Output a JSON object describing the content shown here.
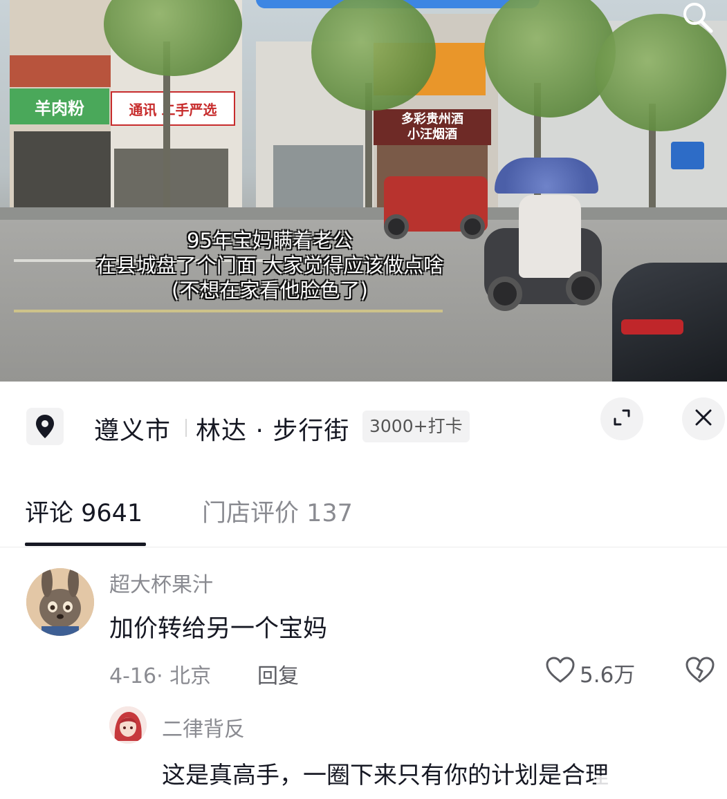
{
  "video": {
    "caption_lines": [
      "95年宝妈瞒着老公",
      "在县城盘了个门面 大家觉得应该做点啥",
      "(不想在家看他脸色了)"
    ],
    "shop_signs": [
      "羊肉粉",
      "通讯 二手严选",
      "多彩贵州酒",
      "小汪烟酒"
    ],
    "search_icon": "search-icon"
  },
  "location": {
    "icon": "location-pin-icon",
    "city": "遵义市",
    "street": "林达 · 步行街",
    "checkins": "3000+打卡",
    "expand_icon": "expand-icon",
    "close_icon": "close-icon"
  },
  "tabs": [
    {
      "label": "评论 9641",
      "active": true
    },
    {
      "label": "门店评价 137",
      "active": false
    }
  ],
  "comments": [
    {
      "username": "超大杯果汁",
      "text": "加价转给另一个宝妈",
      "date_location": "4-16· 北京",
      "reply_label": "回复",
      "likes": "5.6万",
      "like_icon": "heart-icon",
      "dislike_icon": "broken-heart-icon"
    }
  ],
  "replies": [
    {
      "username": "二律背反",
      "text": "这是真高手，一圈下来只有你的计划是合理"
    }
  ],
  "colors": {
    "text_primary": "#161823",
    "text_secondary": "#8a8b91",
    "chip_bg": "#f2f2f3",
    "accent_blue": "#3d86e3"
  }
}
